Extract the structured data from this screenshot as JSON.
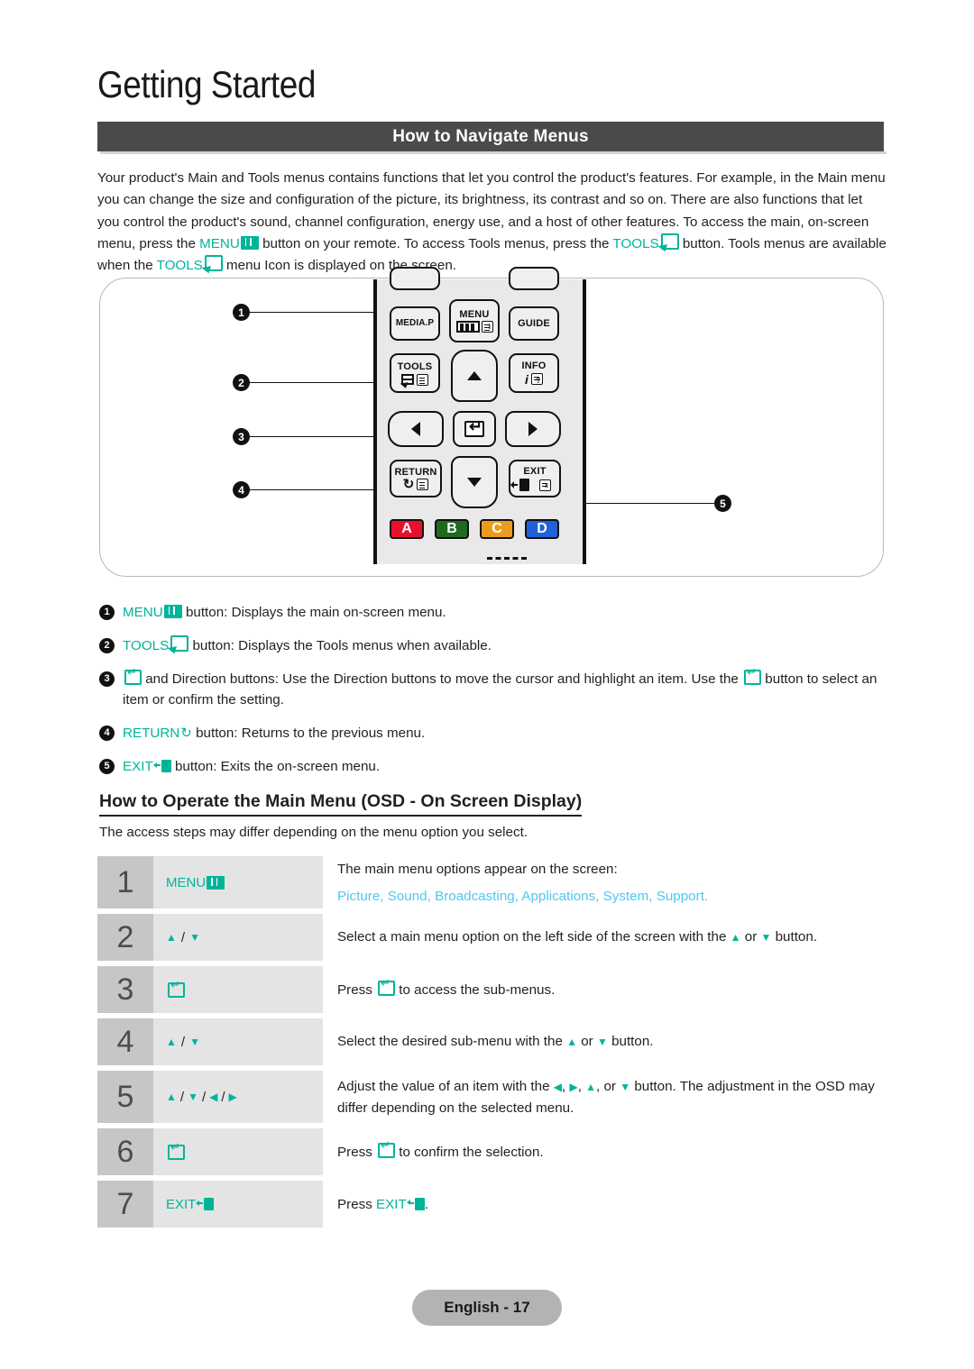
{
  "header": {
    "chapter_title": "Getting Started",
    "section_title": "How to Navigate Menus"
  },
  "intro": {
    "part1": "Your product's Main and Tools menus contains functions that let you control the product's features. For example, in the Main menu you can change the size and configuration of the picture, its brightness, its contrast and so on. There are also functions that let you control the product's sound, channel configuration, energy use, and a host of other features. To access the main, on-screen menu, press the ",
    "menu_label": "MENU",
    "part2": " button on your remote. To access Tools menus, press the ",
    "tools_label": "TOOLS",
    "part3": " button. Tools menus are available when the ",
    "tools_label2": "TOOLS",
    "part4": " menu Icon is displayed on the screen."
  },
  "remote": {
    "buttons": {
      "media_p": "MEDIA.P",
      "menu": "MENU",
      "guide": "GUIDE",
      "tools": "TOOLS",
      "info": "INFO",
      "info_i": "i",
      "return": "RETURN",
      "exit": "EXIT"
    },
    "color_buttons": [
      {
        "label": "A",
        "color": "#e8112d"
      },
      {
        "label": "B",
        "color": "#1e6b1e"
      },
      {
        "label": "C",
        "color": "#eb9b1e"
      },
      {
        "label": "D",
        "color": "#2060d8"
      }
    ],
    "callouts": [
      "1",
      "2",
      "3",
      "4",
      "5"
    ]
  },
  "legend": [
    {
      "num": "1",
      "key": "MENU",
      "icon": "menu-icon",
      "text": " button: Displays the main on-screen menu."
    },
    {
      "num": "2",
      "key": "TOOLS",
      "icon": "tools-icon",
      "text": " button: Displays the Tools menus when available."
    },
    {
      "num": "3",
      "key": "",
      "icon": "enter-icon",
      "text": " and Direction buttons: Use the Direction buttons to move the cursor and highlight an item. Use the ",
      "text2": " button to select an item or confirm the setting."
    },
    {
      "num": "4",
      "key": "RETURN",
      "icon": "return-icon",
      "text": " button: Returns to the previous menu."
    },
    {
      "num": "5",
      "key": "EXIT",
      "icon": "exit-icon",
      "text": " button: Exits the on-screen menu."
    }
  ],
  "osd": {
    "heading": "How to Operate the Main Menu (OSD - On Screen Display)",
    "note": "The access steps may differ depending on the menu option you select."
  },
  "steps": [
    {
      "num": "1",
      "key_label": "MENU",
      "key_icon": "menu-icon",
      "desc": "The main menu options appear on the screen:",
      "menu_options": "Picture, Sound, Broadcasting, Applications, System, Support."
    },
    {
      "num": "2",
      "key_label": "",
      "key_icon": "up-down-icons",
      "desc_pre": "Select a main menu option on the left side of the screen with the ",
      "desc_mid": " or ",
      "desc_post": " button."
    },
    {
      "num": "3",
      "key_label": "",
      "key_icon": "enter-icon",
      "desc_pre": "Press ",
      "desc_post": " to access the sub-menus."
    },
    {
      "num": "4",
      "key_label": "",
      "key_icon": "up-down-icons",
      "desc_pre": "Select the desired sub-menu with the ",
      "desc_mid": " or ",
      "desc_post": " button."
    },
    {
      "num": "5",
      "key_label": "",
      "key_icon": "up-down-left-right-icons",
      "desc_pre": "Adjust the value of an item with the ",
      "desc_post": " button. The adjustment in the OSD may differ depending on the selected menu."
    },
    {
      "num": "6",
      "key_label": "",
      "key_icon": "enter-icon",
      "desc_pre": "Press ",
      "desc_post": " to confirm the selection."
    },
    {
      "num": "7",
      "key_label": "EXIT",
      "key_icon": "exit-icon",
      "desc_pre": "Press ",
      "desc_label": "EXIT",
      "desc_post": "."
    }
  ],
  "footer": {
    "page_label": "English - 17"
  },
  "colors": {
    "teal": "#00b49a",
    "sky": "#4fc7f5",
    "section_bar": "#4a4a4a",
    "step_num_bg": "#c6c6c6",
    "step_key_bg": "#e4e4e4",
    "footer_bg": "#b3b3b3"
  }
}
